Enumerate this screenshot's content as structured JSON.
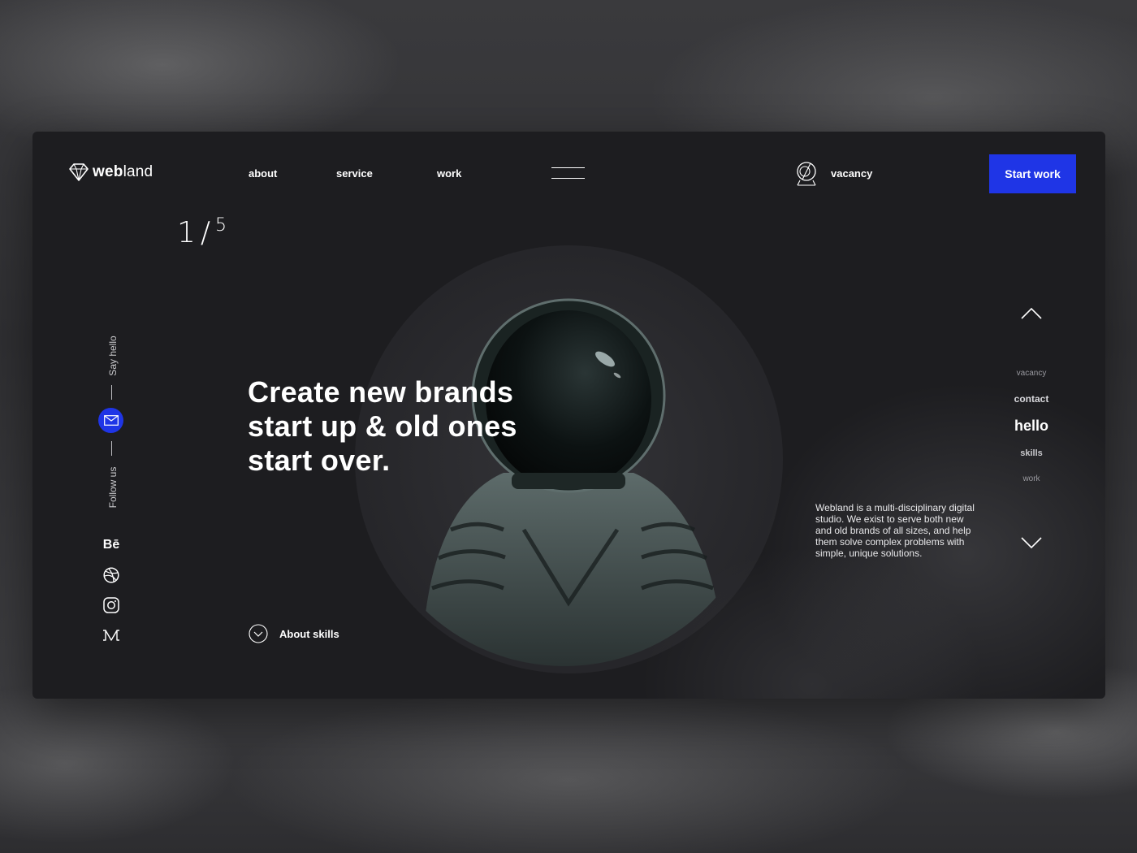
{
  "brand": {
    "logo_bold": "web",
    "logo_light": "land"
  },
  "nav": {
    "about": "about",
    "service": "service",
    "work": "work",
    "vacancy": "vacancy"
  },
  "cta": {
    "start_work": "Start work"
  },
  "slide": {
    "current": "1",
    "separator": "/",
    "total": "5"
  },
  "hero": {
    "line1": "Create new brands",
    "line2": "start up & old ones",
    "line3": "start over.",
    "about_skills": "About skills"
  },
  "sidebar_left": {
    "say_hello": "Say hello",
    "follow_us": "Follow us",
    "behance": "Bē"
  },
  "sidebar_right": {
    "items": [
      "vacancy",
      "contact",
      "hello",
      "skills",
      "work"
    ],
    "active": "hello"
  },
  "description": "Webland is a multi-disciplinary digital studio. We exist to serve both new and old brands of all sizes, and help them solve complex problems with simple, unique solutions.",
  "colors": {
    "accent": "#1f35e6",
    "card": "#1d1d20",
    "text": "#ffffff"
  },
  "icons": [
    "diamond-logo-icon",
    "hamburger-menu-icon",
    "astronaut-helmet-icon",
    "mail-icon",
    "behance-icon",
    "dribbble-icon",
    "instagram-icon",
    "medium-icon",
    "chevron-up-icon",
    "chevron-down-icon",
    "chevron-down-circle-icon"
  ]
}
